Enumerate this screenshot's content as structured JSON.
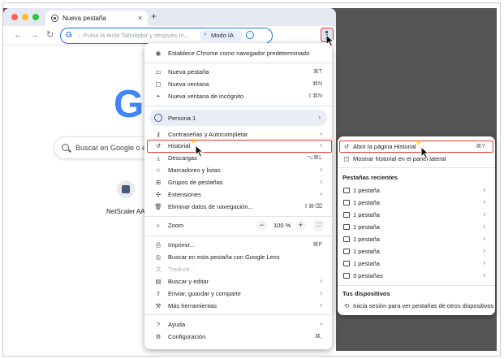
{
  "browser": {
    "tab_title": "Nueva pestaña",
    "tab_close": "×",
    "new_tab": "+",
    "omnibox_placeholder": "→ Pulsa la tecla Tabulador y después In...",
    "ai_mode_label": "Modo IA"
  },
  "ntp": {
    "search_text": "Buscar en Google o esc",
    "shortcut_label": "NetScaler AAA"
  },
  "menu": {
    "default_browser": "Establece Chrome como navegador predeterminado",
    "new_tab": {
      "label": "Nueva pestaña",
      "shortcut": "⌘T"
    },
    "new_window": {
      "label": "Nueva ventana",
      "shortcut": "⌘N"
    },
    "incognito": {
      "label": "Nueva ventana de incógnito",
      "shortcut": "⇧⌘N"
    },
    "persona": "Persona 1",
    "passwords": "Contraseñas y Autocompletar",
    "history": "Historial",
    "downloads": {
      "label": "Descargas",
      "shortcut": "⌥⌘L"
    },
    "bookmarks": "Marcadores y listas",
    "tab_groups": "Grupos de pestañas",
    "extensions": "Extensiones",
    "clear_data": {
      "label": "Eliminar datos de navegación...",
      "shortcut": "⇧⌘⌫"
    },
    "zoom": {
      "label": "Zoom",
      "minus": "−",
      "value": "100 %",
      "plus": "+"
    },
    "print": {
      "label": "Imprimir...",
      "shortcut": "⌘P"
    },
    "lens": "Buscar en esta pestaña con Google Lens",
    "translate": "Traducir...",
    "find_edit": "Buscar y editar",
    "send_save": "Enviar, guardar y compartir",
    "more_tools": "Más herramientas",
    "help": "Ayuda",
    "settings": {
      "label": "Configuración",
      "shortcut": "⌘,"
    }
  },
  "history_submenu": {
    "open_history": {
      "label": "Abrir la página Historial",
      "shortcut": "⌘Y"
    },
    "side_panel": "Mostrar historial en el panel lateral",
    "recent_tabs_heading": "Pestañas recientes",
    "recent_tabs": [
      {
        "label": "1 pestaña"
      },
      {
        "label": "1 pestaña"
      },
      {
        "label": "1 pestaña"
      },
      {
        "label": "1 pestaña"
      },
      {
        "label": "1 pestaña"
      },
      {
        "label": "1 pestaña"
      },
      {
        "label": "1 pestaña"
      },
      {
        "label": "3 pestañas"
      }
    ],
    "devices_heading": "Tus dispositivos",
    "devices_signin": "Inicia sesión para ver pestañas de otros dispositivos"
  },
  "colors": {
    "accent": "#1a73e8",
    "highlight_border": "#e53935",
    "desktop": "#555555"
  }
}
